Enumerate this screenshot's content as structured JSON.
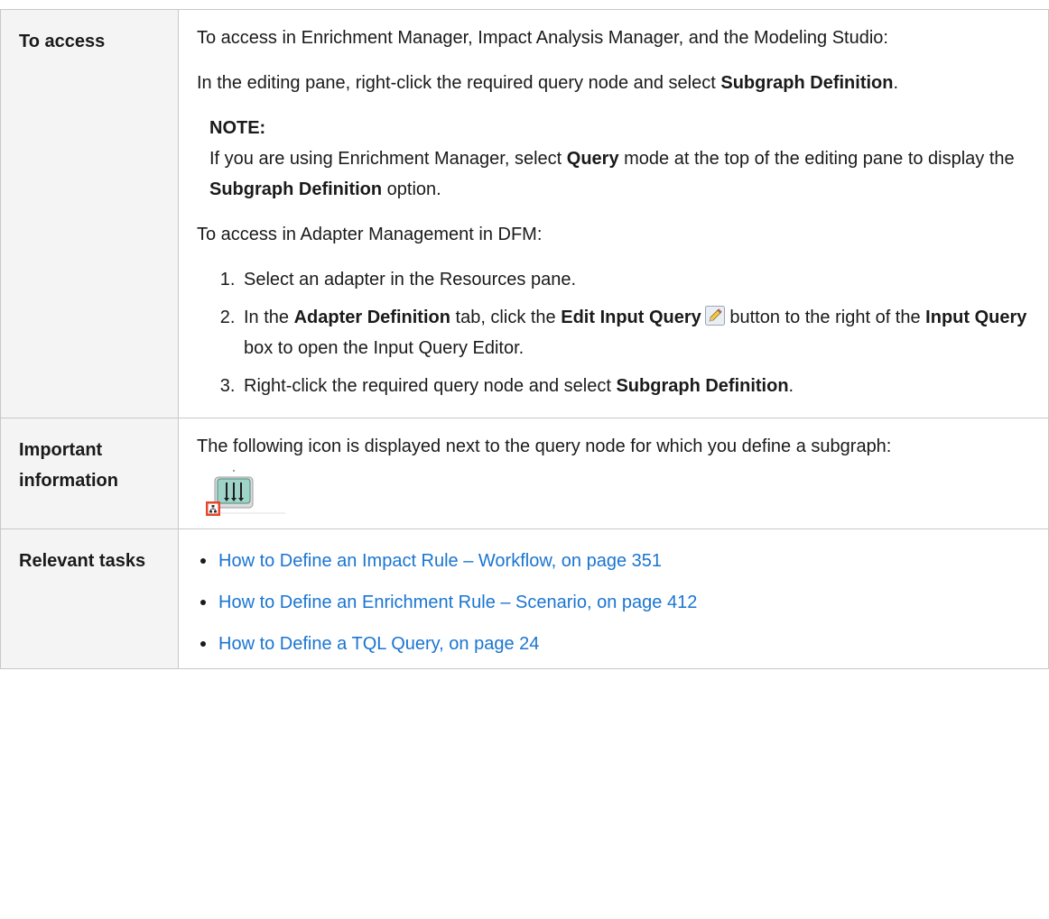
{
  "rows": {
    "access": {
      "label": "To access",
      "intro": "To access in Enrichment Manager, Impact Analysis Manager, and the Modeling Studio:",
      "editing_pre": "In the editing pane, right-click the required query node and select ",
      "editing_bold": "Subgraph Definition",
      "editing_post": ".",
      "note": {
        "title": "NOTE:",
        "pre": "If you are using Enrichment Manager, select ",
        "bold1": "Query",
        "mid": " mode at the top of the editing pane to display the ",
        "bold2": "Subgraph Definition",
        "post": " option."
      },
      "dfm_intro": "To access in Adapter Management in DFM:",
      "steps": {
        "s1": "Select an adapter in the Resources pane.",
        "s2_pre": "In the ",
        "s2_b1": "Adapter Definition",
        "s2_mid1": " tab, click the ",
        "s2_b2": "Edit Input Query",
        "s2_mid2": " button to the right of the ",
        "s2_b3": "Input Query",
        "s2_post": " box to open the Input Query Editor.",
        "s3_pre": "Right-click the required query node and select ",
        "s3_b": "Subgraph Definition",
        "s3_post": "."
      }
    },
    "important": {
      "label": "Important information",
      "text": "The following icon is displayed next to the query node for which you define a subgraph:"
    },
    "tasks": {
      "label": "Relevant tasks",
      "links": [
        "How to Define an Impact Rule – Workflow, on page 351",
        "How to Define an Enrichment Rule – Scenario, on page 412",
        "How to Define a TQL Query, on page 24"
      ]
    }
  },
  "icons": {
    "edit": "pencil-icon",
    "subgraph": "subgraph-node-icon"
  },
  "colors": {
    "link": "#1a75d1",
    "label_bg": "#f4f4f4",
    "border": "#c8c8c8",
    "subgraph_badge": "#e8452c"
  }
}
